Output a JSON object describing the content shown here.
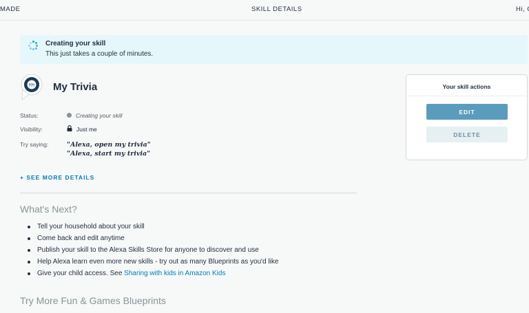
{
  "header": {
    "left_text": "MADE",
    "center_title": "SKILL DETAILS",
    "right_text": "Hi, C"
  },
  "banner": {
    "icon": "loading-spinner-icon",
    "title": "Creating your skill",
    "subtitle": "This just takes a couple of minutes."
  },
  "skill": {
    "icon": "trivia-speech-bubble-icon",
    "icon_text": "??!",
    "name": "My Trivia",
    "details": {
      "status_label": "Status:",
      "status_value": "Creating your skill",
      "visibility_label": "Visibility:",
      "visibility_value": "Just me",
      "try_saying_label": "Try saying:",
      "phrases": [
        "\"Alexa, open my trivia\"",
        "\"Alexa, start my trivia\""
      ]
    },
    "see_more_label": "+ SEE MORE DETAILS"
  },
  "whats_next": {
    "title": "What's Next?",
    "items": [
      "Tell your household about your skill",
      "Come back and edit anytime",
      "Publish your skill to the Alexa Skills Store for anyone to discover and use",
      "Help Alexa learn even more new skills - try out as many Blueprints as you'd like"
    ],
    "kids_item_prefix": "Give your child access. See ",
    "kids_link": "Sharing with kids in Amazon Kids"
  },
  "more_blueprints_title": "Try More Fun & Games Blueprints",
  "actions": {
    "title": "Your skill actions",
    "edit_label": "EDIT",
    "delete_label": "DELETE"
  },
  "colors": {
    "accent_link": "#007eb9",
    "edit_button": "#5b9cbc",
    "banner_bg": "#e6f7fc",
    "skill_icon_bg": "#1b3a52"
  }
}
